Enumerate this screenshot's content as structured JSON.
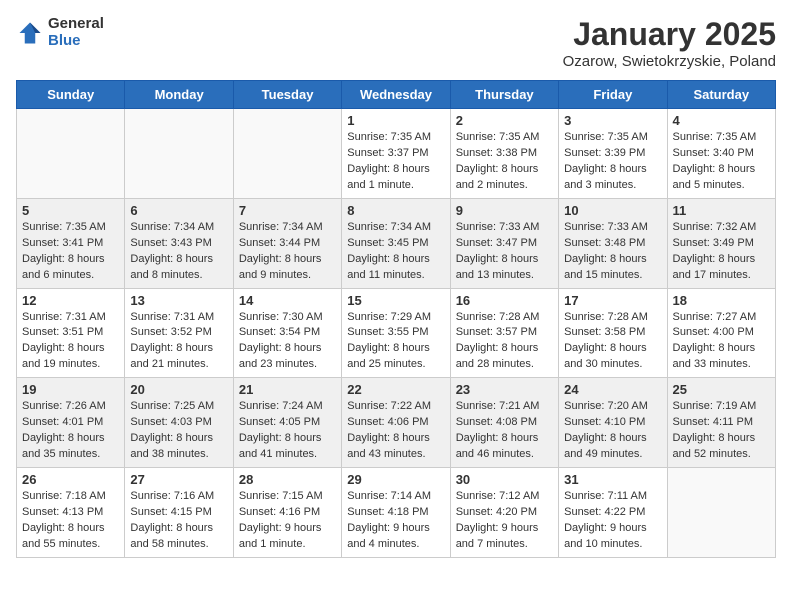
{
  "header": {
    "logo_general": "General",
    "logo_blue": "Blue",
    "title": "January 2025",
    "subtitle": "Ozarow, Swietokrzyskie, Poland"
  },
  "weekdays": [
    "Sunday",
    "Monday",
    "Tuesday",
    "Wednesday",
    "Thursday",
    "Friday",
    "Saturday"
  ],
  "weeks": [
    [
      {
        "day": "",
        "info": ""
      },
      {
        "day": "",
        "info": ""
      },
      {
        "day": "",
        "info": ""
      },
      {
        "day": "1",
        "info": "Sunrise: 7:35 AM\nSunset: 3:37 PM\nDaylight: 8 hours\nand 1 minute."
      },
      {
        "day": "2",
        "info": "Sunrise: 7:35 AM\nSunset: 3:38 PM\nDaylight: 8 hours\nand 2 minutes."
      },
      {
        "day": "3",
        "info": "Sunrise: 7:35 AM\nSunset: 3:39 PM\nDaylight: 8 hours\nand 3 minutes."
      },
      {
        "day": "4",
        "info": "Sunrise: 7:35 AM\nSunset: 3:40 PM\nDaylight: 8 hours\nand 5 minutes."
      }
    ],
    [
      {
        "day": "5",
        "info": "Sunrise: 7:35 AM\nSunset: 3:41 PM\nDaylight: 8 hours\nand 6 minutes."
      },
      {
        "day": "6",
        "info": "Sunrise: 7:34 AM\nSunset: 3:43 PM\nDaylight: 8 hours\nand 8 minutes."
      },
      {
        "day": "7",
        "info": "Sunrise: 7:34 AM\nSunset: 3:44 PM\nDaylight: 8 hours\nand 9 minutes."
      },
      {
        "day": "8",
        "info": "Sunrise: 7:34 AM\nSunset: 3:45 PM\nDaylight: 8 hours\nand 11 minutes."
      },
      {
        "day": "9",
        "info": "Sunrise: 7:33 AM\nSunset: 3:47 PM\nDaylight: 8 hours\nand 13 minutes."
      },
      {
        "day": "10",
        "info": "Sunrise: 7:33 AM\nSunset: 3:48 PM\nDaylight: 8 hours\nand 15 minutes."
      },
      {
        "day": "11",
        "info": "Sunrise: 7:32 AM\nSunset: 3:49 PM\nDaylight: 8 hours\nand 17 minutes."
      }
    ],
    [
      {
        "day": "12",
        "info": "Sunrise: 7:31 AM\nSunset: 3:51 PM\nDaylight: 8 hours\nand 19 minutes."
      },
      {
        "day": "13",
        "info": "Sunrise: 7:31 AM\nSunset: 3:52 PM\nDaylight: 8 hours\nand 21 minutes."
      },
      {
        "day": "14",
        "info": "Sunrise: 7:30 AM\nSunset: 3:54 PM\nDaylight: 8 hours\nand 23 minutes."
      },
      {
        "day": "15",
        "info": "Sunrise: 7:29 AM\nSunset: 3:55 PM\nDaylight: 8 hours\nand 25 minutes."
      },
      {
        "day": "16",
        "info": "Sunrise: 7:28 AM\nSunset: 3:57 PM\nDaylight: 8 hours\nand 28 minutes."
      },
      {
        "day": "17",
        "info": "Sunrise: 7:28 AM\nSunset: 3:58 PM\nDaylight: 8 hours\nand 30 minutes."
      },
      {
        "day": "18",
        "info": "Sunrise: 7:27 AM\nSunset: 4:00 PM\nDaylight: 8 hours\nand 33 minutes."
      }
    ],
    [
      {
        "day": "19",
        "info": "Sunrise: 7:26 AM\nSunset: 4:01 PM\nDaylight: 8 hours\nand 35 minutes."
      },
      {
        "day": "20",
        "info": "Sunrise: 7:25 AM\nSunset: 4:03 PM\nDaylight: 8 hours\nand 38 minutes."
      },
      {
        "day": "21",
        "info": "Sunrise: 7:24 AM\nSunset: 4:05 PM\nDaylight: 8 hours\nand 41 minutes."
      },
      {
        "day": "22",
        "info": "Sunrise: 7:22 AM\nSunset: 4:06 PM\nDaylight: 8 hours\nand 43 minutes."
      },
      {
        "day": "23",
        "info": "Sunrise: 7:21 AM\nSunset: 4:08 PM\nDaylight: 8 hours\nand 46 minutes."
      },
      {
        "day": "24",
        "info": "Sunrise: 7:20 AM\nSunset: 4:10 PM\nDaylight: 8 hours\nand 49 minutes."
      },
      {
        "day": "25",
        "info": "Sunrise: 7:19 AM\nSunset: 4:11 PM\nDaylight: 8 hours\nand 52 minutes."
      }
    ],
    [
      {
        "day": "26",
        "info": "Sunrise: 7:18 AM\nSunset: 4:13 PM\nDaylight: 8 hours\nand 55 minutes."
      },
      {
        "day": "27",
        "info": "Sunrise: 7:16 AM\nSunset: 4:15 PM\nDaylight: 8 hours\nand 58 minutes."
      },
      {
        "day": "28",
        "info": "Sunrise: 7:15 AM\nSunset: 4:16 PM\nDaylight: 9 hours\nand 1 minute."
      },
      {
        "day": "29",
        "info": "Sunrise: 7:14 AM\nSunset: 4:18 PM\nDaylight: 9 hours\nand 4 minutes."
      },
      {
        "day": "30",
        "info": "Sunrise: 7:12 AM\nSunset: 4:20 PM\nDaylight: 9 hours\nand 7 minutes."
      },
      {
        "day": "31",
        "info": "Sunrise: 7:11 AM\nSunset: 4:22 PM\nDaylight: 9 hours\nand 10 minutes."
      },
      {
        "day": "",
        "info": ""
      }
    ]
  ]
}
